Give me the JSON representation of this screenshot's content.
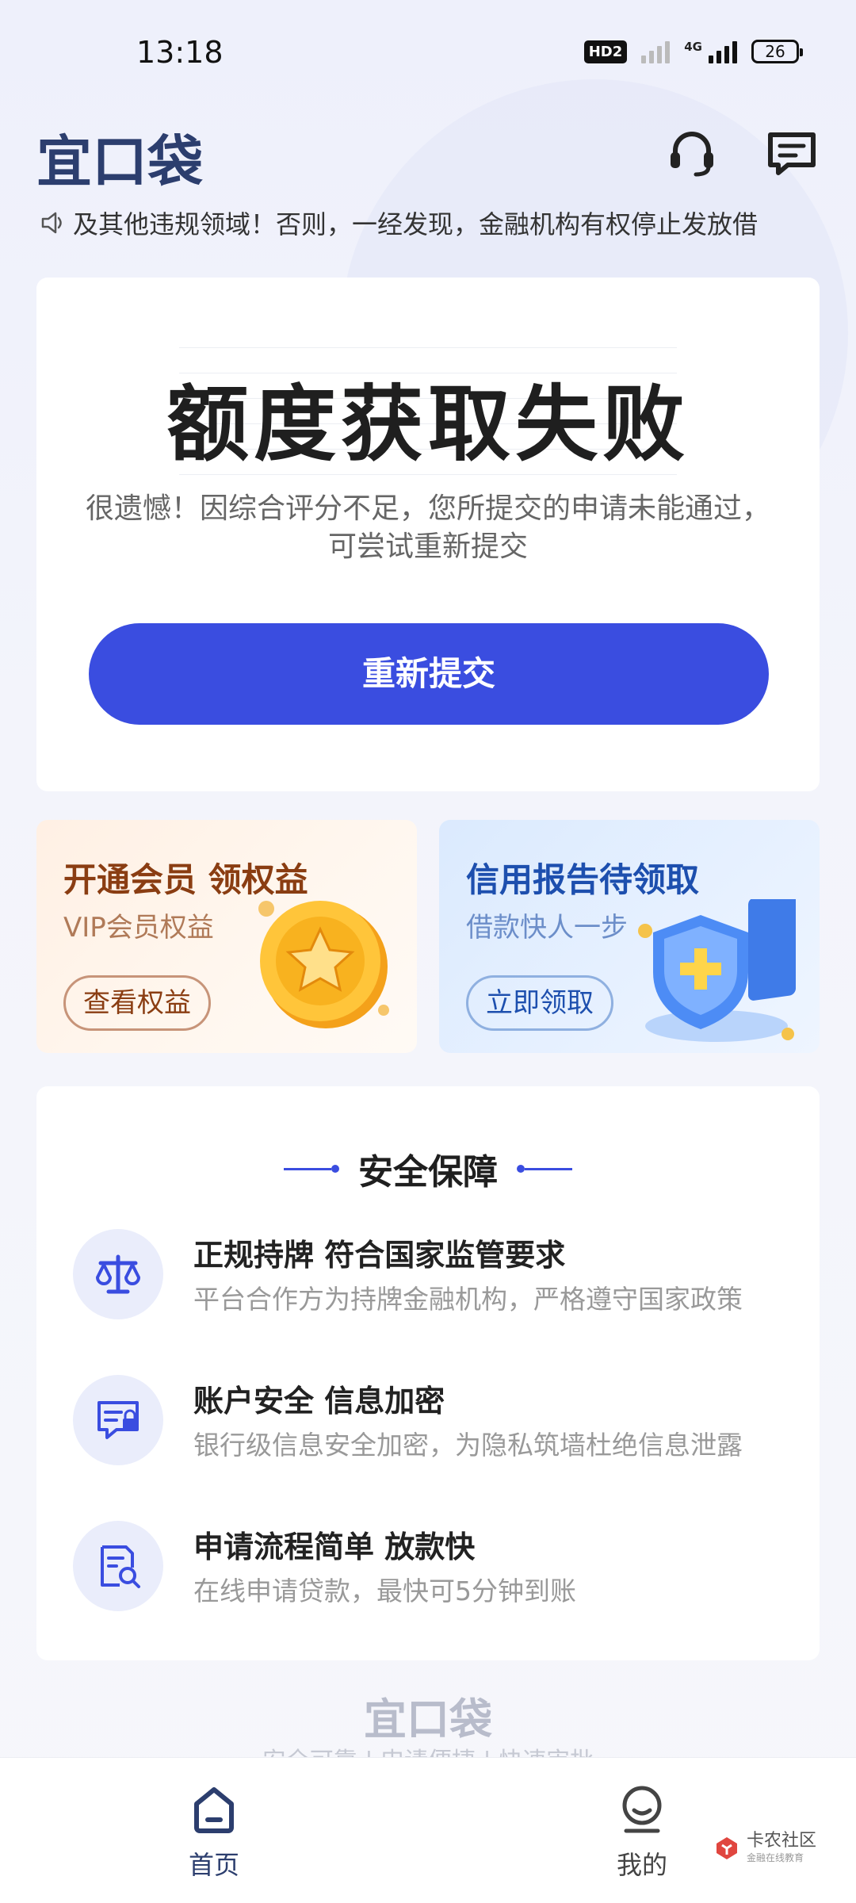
{
  "status_bar": {
    "time": "13:18",
    "hd_badge": "HD2",
    "network_label": "4G",
    "battery": "26"
  },
  "header": {
    "logo": "宜口袋",
    "notice_text": "及其他违规领域！否则，一经发现，金融机构有权停止发放借"
  },
  "result": {
    "title": "额度获取失败",
    "description": "很遗憾！因综合评分不足，您所提交的申请未能通过，可尝试重新提交",
    "resubmit_label": "重新提交"
  },
  "promos": {
    "vip": {
      "title": "开通会员 领权益",
      "subtitle": "VIP会员权益",
      "button_label": "查看权益"
    },
    "credit": {
      "title": "信用报告待领取",
      "subtitle": "借款快人一步",
      "button_label": "立即领取"
    }
  },
  "security": {
    "title": "安全保障",
    "items": [
      {
        "title": "正规持牌 符合国家监管要求",
        "desc": "平台合作方为持牌金融机构，严格遵守国家政策",
        "icon": "scale-icon"
      },
      {
        "title": "账户安全 信息加密",
        "desc": "银行级信息安全加密，为隐私筑墙杜绝信息泄露",
        "icon": "secure-chat-icon"
      },
      {
        "title": "申请流程简单 放款快",
        "desc": "在线申请贷款，最快可5分钟到账",
        "icon": "document-search-icon"
      }
    ]
  },
  "footer": {
    "logo": "宜口袋",
    "slogan": "安全可靠 | 申请便捷 | 快速审批"
  },
  "tabbar": {
    "home_label": "首页",
    "mine_label": "我的"
  },
  "watermark": {
    "text": "卡农社区",
    "sub": "金融在线教育"
  },
  "colors": {
    "primary": "#3a4de0",
    "brand_dark": "#2c3e6e",
    "vip_text": "#8a3d12",
    "credit_text": "#1d4fae"
  }
}
